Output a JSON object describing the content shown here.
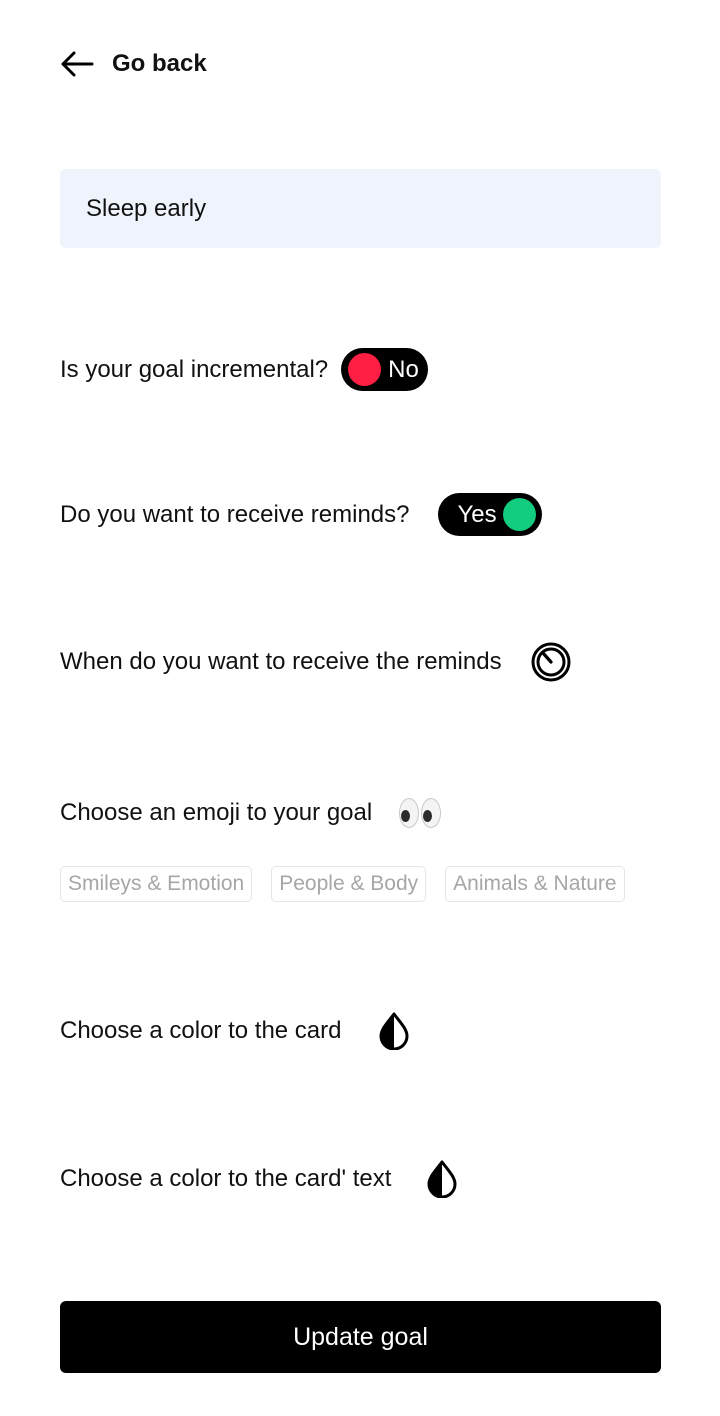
{
  "header": {
    "back_label": "Go back"
  },
  "goal": {
    "name": "Sleep early"
  },
  "incremental": {
    "label": "Is your goal incremental?",
    "toggle_text": "No",
    "value": false
  },
  "reminds": {
    "label": "Do you want to receive reminds?",
    "toggle_text": "Yes",
    "value": true
  },
  "remind_time": {
    "label": "When do you want to receive the reminds",
    "icon": "timer-icon"
  },
  "emoji": {
    "label": "Choose an emoji to your goal",
    "selected": "👀",
    "categories": [
      "Smileys & Emotion",
      "People & Body",
      "Animals & Nature"
    ]
  },
  "card_color": {
    "label": "Choose a color to the card",
    "icon": "color-drop-icon"
  },
  "card_text_color": {
    "label": "Choose a color to the card' text",
    "icon": "color-drop-icon"
  },
  "submit": {
    "label": "Update goal"
  },
  "colors": {
    "toggle_off": "#ff1f44",
    "toggle_on": "#12cc7f",
    "input_bg": "#eff4fc",
    "primary": "#000000"
  }
}
